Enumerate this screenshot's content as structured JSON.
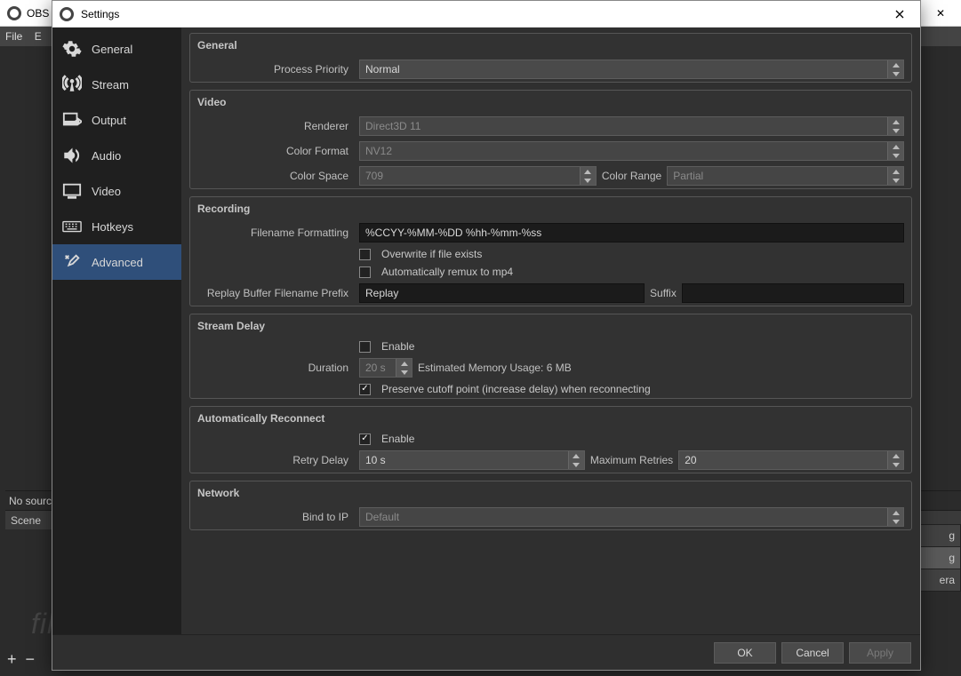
{
  "bg": {
    "title_short": "OBS",
    "menu": {
      "file": "File",
      "edit_short": "E"
    },
    "no_source": "No sourc",
    "scene_header": "Scene",
    "right_items": [
      "g",
      "g",
      "era"
    ]
  },
  "dialog": {
    "title": "Settings"
  },
  "sidebar": {
    "items": [
      {
        "label": "General"
      },
      {
        "label": "Stream"
      },
      {
        "label": "Output"
      },
      {
        "label": "Audio"
      },
      {
        "label": "Video"
      },
      {
        "label": "Hotkeys"
      },
      {
        "label": "Advanced"
      }
    ]
  },
  "general": {
    "title": "General",
    "priority_label": "Process Priority",
    "priority_value": "Normal"
  },
  "video": {
    "title": "Video",
    "renderer_label": "Renderer",
    "renderer_value": "Direct3D 11",
    "format_label": "Color Format",
    "format_value": "NV12",
    "space_label": "Color Space",
    "space_value": "709",
    "range_label": "Color Range",
    "range_value": "Partial"
  },
  "recording": {
    "title": "Recording",
    "filename_label": "Filename Formatting",
    "filename_value": "%CCYY-%MM-%DD %hh-%mm-%ss",
    "overwrite_label": "Overwrite if file exists",
    "remux_label": "Automatically remux to mp4",
    "prefix_label": "Replay Buffer Filename Prefix",
    "prefix_value": "Replay",
    "suffix_label": "Suffix",
    "suffix_value": ""
  },
  "delay": {
    "title": "Stream Delay",
    "enable_label": "Enable",
    "duration_label": "Duration",
    "duration_value": "20 s",
    "memory_label": "Estimated Memory Usage: 6 MB",
    "preserve_label": "Preserve cutoff point (increase delay) when reconnecting"
  },
  "reconnect": {
    "title": "Automatically Reconnect",
    "enable_label": "Enable",
    "retry_label": "Retry Delay",
    "retry_value": "10 s",
    "max_label": "Maximum Retries",
    "max_value": "20"
  },
  "network": {
    "title": "Network",
    "bind_label": "Bind to IP",
    "bind_value": "Default"
  },
  "buttons": {
    "ok": "OK",
    "cancel": "Cancel",
    "apply": "Apply"
  },
  "watermark": "filehorse.com"
}
